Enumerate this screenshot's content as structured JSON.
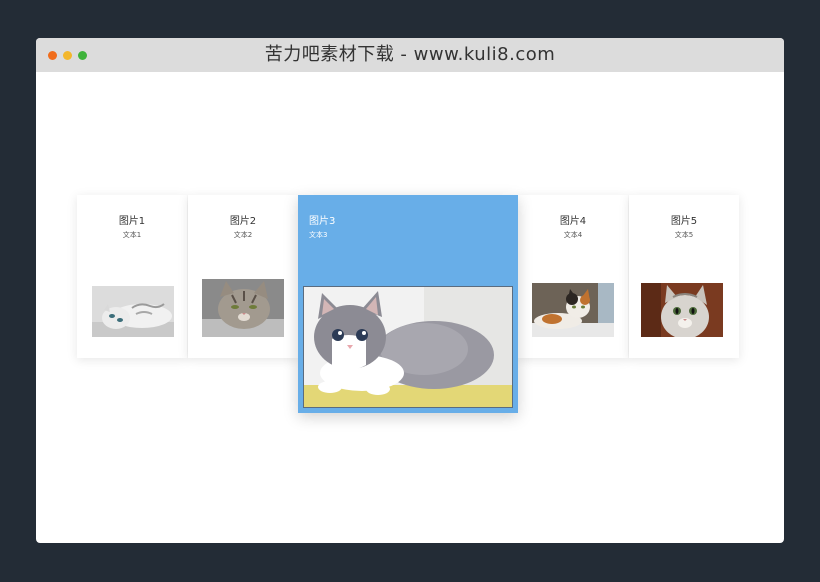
{
  "window": {
    "title": "苦力吧素材下载 - www.kuli8.com",
    "traffic_lights": [
      "close",
      "minimize",
      "zoom"
    ],
    "colors": {
      "close": "#f06d1c",
      "minimize": "#f3b72c",
      "zoom": "#3fb33b"
    }
  },
  "slider": {
    "active_index": 2,
    "active_color": "#68aee8",
    "cards": [
      {
        "title": "图片1",
        "subtitle": "文本1",
        "image": "cat-lying-photo"
      },
      {
        "title": "图片2",
        "subtitle": "文本2",
        "image": "tabby-cat-photo"
      },
      {
        "title": "图片3",
        "subtitle": "文本3",
        "image": "gray-kitten-photo"
      },
      {
        "title": "图片4",
        "subtitle": "文本4",
        "image": "calico-cat-photo"
      },
      {
        "title": "图片5",
        "subtitle": "文本5",
        "image": "silver-cat-photo"
      }
    ]
  }
}
